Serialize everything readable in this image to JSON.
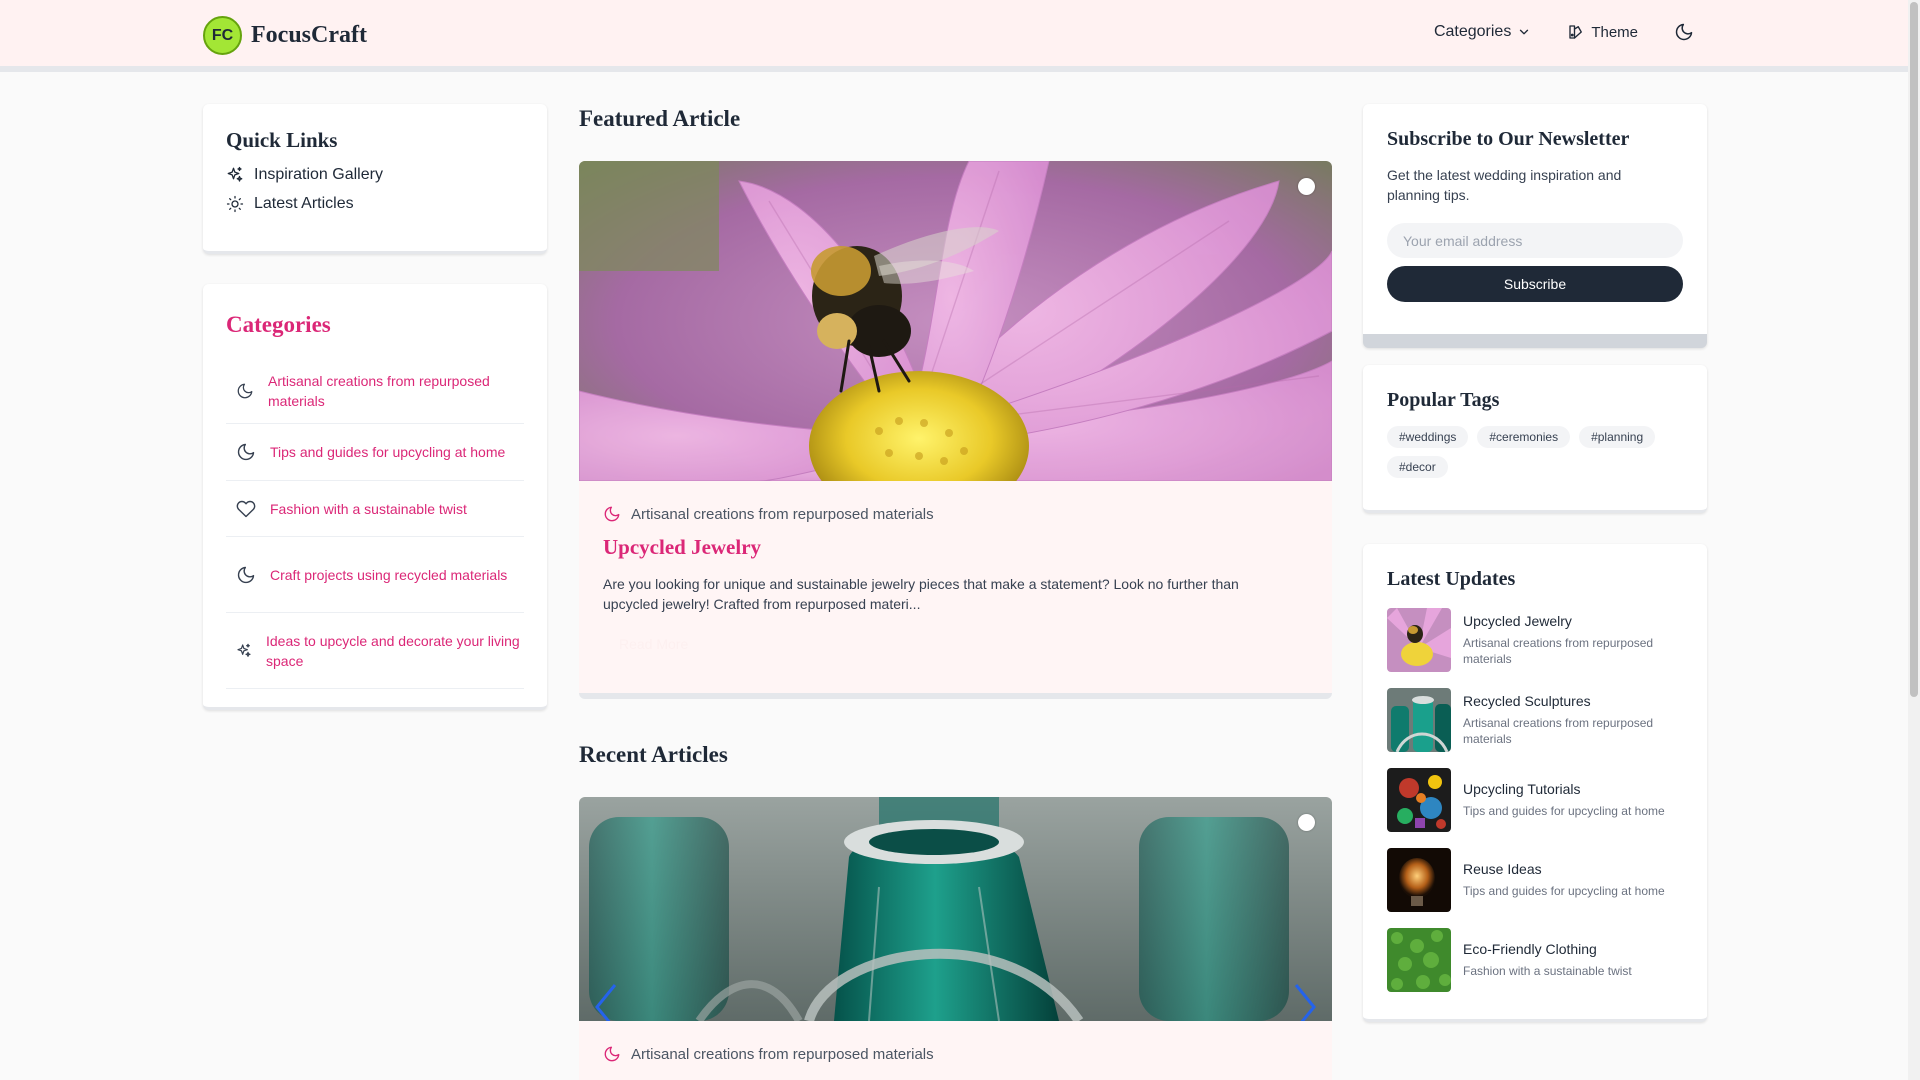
{
  "header": {
    "logo_text": "FC",
    "brand": "FocusCraft",
    "nav": {
      "categories": "Categories",
      "theme": "Theme"
    }
  },
  "quick_links": {
    "title": "Quick Links",
    "items": [
      {
        "label": "Inspiration Gallery",
        "icon": "sparkles-icon"
      },
      {
        "label": "Latest Articles",
        "icon": "sun-icon"
      }
    ]
  },
  "categories": {
    "title": "Categories",
    "items": [
      {
        "label": "Artisanal creations from repurposed materials",
        "icon": "moon-icon"
      },
      {
        "label": "Tips and guides for upcycling at home",
        "icon": "moon-icon"
      },
      {
        "label": "Fashion with a sustainable twist",
        "icon": "heart-icon"
      },
      {
        "label": "Craft projects using recycled materials",
        "icon": "moon-icon"
      },
      {
        "label": "Ideas to upcycle and decorate your living space",
        "icon": "sparkles-icon"
      }
    ]
  },
  "featured": {
    "heading": "Featured Article",
    "category": "Artisanal creations from repurposed materials",
    "title": "Upcycled Jewelry",
    "excerpt": "Are you looking for unique and sustainable jewelry pieces that make a statement? Look no further than upcycled jewelry! Crafted from repurposed materi...",
    "read_more": "Read More",
    "image": "bee-on-pink-flower"
  },
  "recent": {
    "heading": "Recent Articles",
    "category": "Artisanal creations from repurposed materials",
    "image": "green-glass-bottles"
  },
  "newsletter": {
    "title": "Subscribe to Our Newsletter",
    "description": "Get the latest wedding inspiration and planning tips.",
    "placeholder": "Your email address",
    "button": "Subscribe"
  },
  "tags": {
    "title": "Popular Tags",
    "items": [
      "#weddings",
      "#ceremonies",
      "#planning",
      "#decor"
    ]
  },
  "updates": {
    "title": "Latest Updates",
    "items": [
      {
        "title": "Upcycled Jewelry",
        "subtitle": "Artisanal creations from repurposed materials",
        "thumb": "flower"
      },
      {
        "title": "Recycled Sculptures",
        "subtitle": "Artisanal creations from repurposed materials",
        "thumb": "bottles"
      },
      {
        "title": "Upcycling Tutorials",
        "subtitle": "Tips and guides for upcycling at home",
        "thumb": "pattern"
      },
      {
        "title": "Reuse Ideas",
        "subtitle": "Tips and guides for upcycling at home",
        "thumb": "bulb"
      },
      {
        "title": "Eco-Friendly Clothing",
        "subtitle": "Fashion with a sustainable twist",
        "thumb": "grass"
      }
    ]
  },
  "colors": {
    "accent": "#db2777",
    "header_bg": "#fff2f2",
    "button_dark": "#1f2937",
    "logo_green": "#a3e635"
  }
}
